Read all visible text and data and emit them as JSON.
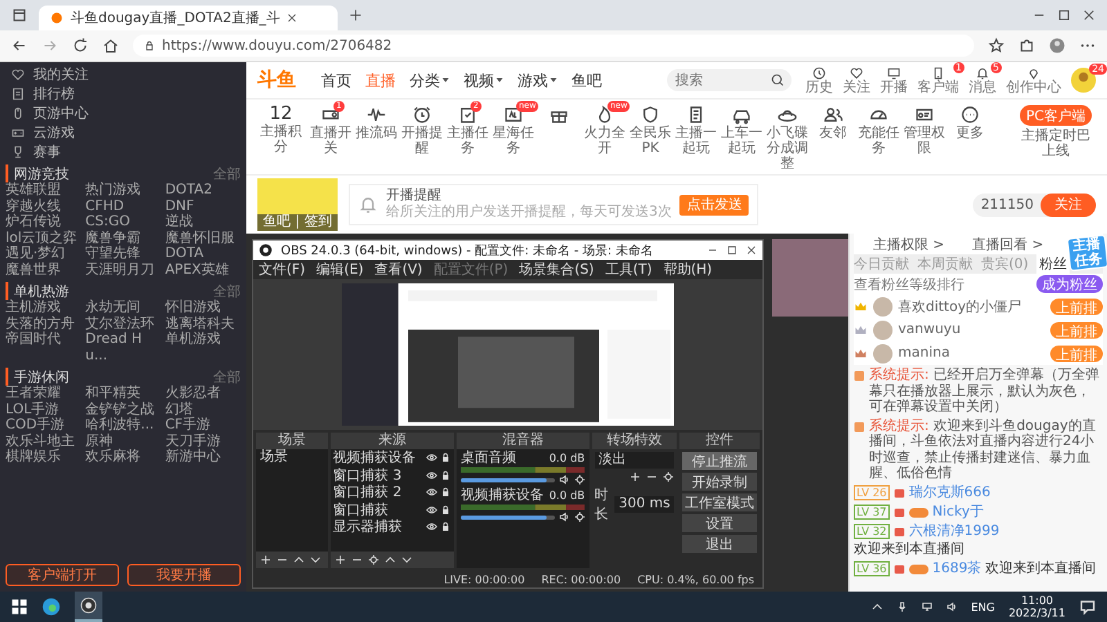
{
  "browser": {
    "tab_title": "斗鱼dougay直播_DOTA2直播_斗",
    "url": "https://www.douyu.com/2706482"
  },
  "nav": {
    "logo": "斗鱼",
    "items": [
      {
        "label": "首页",
        "selected": false,
        "dropdown": false
      },
      {
        "label": "直播",
        "selected": true,
        "dropdown": false
      },
      {
        "label": "分类",
        "selected": false,
        "dropdown": true
      },
      {
        "label": "视频",
        "selected": false,
        "dropdown": true
      },
      {
        "label": "游戏",
        "selected": false,
        "dropdown": true
      },
      {
        "label": "鱼吧",
        "selected": false,
        "dropdown": false
      }
    ],
    "search": {
      "placeholder": "搜索"
    },
    "actions": [
      {
        "label": "历史"
      },
      {
        "label": "关注"
      },
      {
        "label": "开播"
      },
      {
        "label": "客户端",
        "badge": "1"
      },
      {
        "label": "消息",
        "badge": "5"
      },
      {
        "label": "创作中心"
      }
    ],
    "avatar_badge": "24"
  },
  "sidebar": {
    "links": [
      {
        "label": "我的关注"
      },
      {
        "label": "排行榜"
      },
      {
        "label": "页游中心"
      },
      {
        "label": "云游戏"
      },
      {
        "label": "赛事"
      }
    ],
    "sections": [
      {
        "title": "网游竞技",
        "more": "全部",
        "games": [
          "英雄联盟",
          "热门游戏",
          "DOTA2",
          "穿越火线",
          "CFHD",
          "DNF",
          "炉石传说",
          "CS:GO",
          "逆战",
          "lol云顶之弈",
          "魔兽争霸",
          "魔兽怀旧服",
          "遇见·梦幻",
          "守望先锋",
          "DOTA",
          "魔兽世界",
          "天涯明月刀",
          "APEX英雄"
        ]
      },
      {
        "title": "单机热游",
        "more": "全部",
        "games": [
          "主机游戏",
          "永劫无间",
          "怀旧游戏",
          "失落的方舟",
          "艾尔登法环",
          "逃离塔科夫",
          "帝国时代",
          "Dread Hu...",
          "单机游戏"
        ]
      },
      {
        "title": "手游休闲",
        "more": "全部",
        "games": [
          "王者荣耀",
          "和平精英",
          "火影忍者",
          "LOL手游",
          "金铲铲之战",
          "幻塔",
          "COD手游",
          "哈利波特...",
          "CF手游",
          "欢乐斗地主",
          "原神",
          "天刀手游",
          "棋牌娱乐",
          "欢乐麻将",
          "新游中心"
        ]
      }
    ],
    "buttons": [
      "客户端打开",
      "我要开播"
    ]
  },
  "toolbar": {
    "score": "12",
    "score_label": "主播积分",
    "items": [
      {
        "kind": "labeled",
        "label": "直播开关",
        "badge": "1"
      },
      {
        "kind": "labeled",
        "label": "推流码"
      },
      {
        "kind": "labeled",
        "label": "开播提醒"
      },
      {
        "kind": "labeled",
        "label": "主播任务",
        "badge": "2"
      },
      {
        "kind": "labeled",
        "label": "星海任务",
        "badge": "new"
      },
      {
        "kind": "icon"
      },
      {
        "kind": "labeled",
        "label": "火力全开",
        "badge": "new"
      },
      {
        "kind": "labeled",
        "label": "全民乐PK"
      },
      {
        "kind": "labeled",
        "label": "主播一起玩"
      },
      {
        "kind": "labeled",
        "label": "上车一起玩"
      },
      {
        "kind": "labeled",
        "label": "小飞碟分成调整"
      },
      {
        "kind": "labeled",
        "label": "友邻"
      },
      {
        "kind": "labeled",
        "label": "充能任务"
      },
      {
        "kind": "labeled",
        "label": "管理权限"
      },
      {
        "kind": "labeled",
        "label": "更多"
      }
    ],
    "pc_button": "PC客户端",
    "pc_note": "主播定时巴上线"
  },
  "streamer": {
    "avatar_caption": "鱼吧 | 签到",
    "reminder_title": "开播提醒",
    "reminder_text": "给所关注的用户发送开播提醒，每天可发送3次",
    "send_button": "点击发送",
    "count": "211150",
    "follow_button": "关注"
  },
  "obs": {
    "title": "OBS 24.0.3 (64-bit, windows) - 配置文件: 未命名 - 场景: 未命名",
    "menu": [
      {
        "label": "文件(F)",
        "disabled": false
      },
      {
        "label": "编辑(E)",
        "disabled": false
      },
      {
        "label": "查看(V)",
        "disabled": false
      },
      {
        "label": "配置文件(P)",
        "disabled": true
      },
      {
        "label": "场景集合(S)",
        "disabled": false
      },
      {
        "label": "工具(T)",
        "disabled": false
      },
      {
        "label": "帮助(H)",
        "disabled": false
      }
    ],
    "scenes": {
      "title": "场景",
      "items": [
        {
          "label": "场景",
          "selected": false
        }
      ]
    },
    "sources": {
      "title": "来源",
      "items": [
        "视频捕获设备",
        "窗口捕获 3",
        "窗口捕获 2",
        "窗口捕获",
        "显示器捕获"
      ]
    },
    "mixer": {
      "title": "混音器",
      "channels": [
        {
          "name": "桌面音频",
          "reading": "0.0 dB",
          "level": 0.92
        },
        {
          "name": "视频捕获设备",
          "reading": "0.0 dB",
          "level": 0.92
        }
      ]
    },
    "transitions": {
      "title": "转场特效",
      "type": "淡出",
      "duration_label": "时长",
      "duration": "300 ms"
    },
    "controls": {
      "title": "控件",
      "buttons": [
        {
          "label": "停止推流",
          "selected": true
        },
        {
          "label": "开始录制",
          "selected": false
        },
        {
          "label": "工作室模式",
          "selected": false
        },
        {
          "label": "设置",
          "selected": false
        },
        {
          "label": "退出",
          "selected": false
        }
      ]
    },
    "status": {
      "live": "LIVE: 00:00:00",
      "rec": "REC: 00:00:00",
      "cpu": "CPU: 0.4%, 60.00 fps"
    }
  },
  "chat": {
    "header_links": [
      "主播权限 >",
      "直播回看 >"
    ],
    "tabs": [
      {
        "label": "今日贡献",
        "selected": false
      },
      {
        "label": "本周贡献",
        "selected": false
      },
      {
        "label": "贵宾(0)",
        "selected": false
      },
      {
        "label": "粉丝",
        "selected": true
      }
    ],
    "task_badge": "主播任务",
    "rank_title": "查看粉丝等级排行",
    "rank_button": "成为粉丝",
    "ranks": [
      {
        "name": "喜欢dittoy的小僵尸",
        "action": "上前排",
        "color": "#f0b400"
      },
      {
        "name": "vanwuyu",
        "action": "上前排",
        "color": "#b0b0c0"
      },
      {
        "name": "manina",
        "action": "上前排",
        "color": "#d08060"
      }
    ],
    "messages": [
      {
        "prefix": "系统提示:",
        "text": "已经开启万全弹幕（万全弹幕只在播放器上展示，默认为灰色，可在弹幕设置中关闭）"
      },
      {
        "prefix": "系统提示:",
        "text": "欢迎来到斗鱼dougay的直播间，斗鱼依法对直播内容进行24小时巡查，禁止传播封建迷信、暴力血腥、低俗色情"
      }
    ],
    "lines": [
      {
        "level": "LV 26",
        "color": "#f0a040",
        "fan_badge": false,
        "name": "瑞尔克斯666"
      },
      {
        "level": "LV 37",
        "color": "#70b040",
        "fan_badge": true,
        "name": "Nicky于"
      },
      {
        "level": "LV 32",
        "color": "#70b040",
        "fan_badge": false,
        "name": "六根清净1999",
        "text": "欢迎来到本直播间"
      },
      {
        "level": "LV 36",
        "color": "#70b040",
        "fan_badge": true,
        "name": "1689茶",
        "text": "欢迎来到本直播间"
      }
    ]
  },
  "taskbar": {
    "lang": "ENG",
    "time": "11:00",
    "date": "2022/3/11"
  }
}
